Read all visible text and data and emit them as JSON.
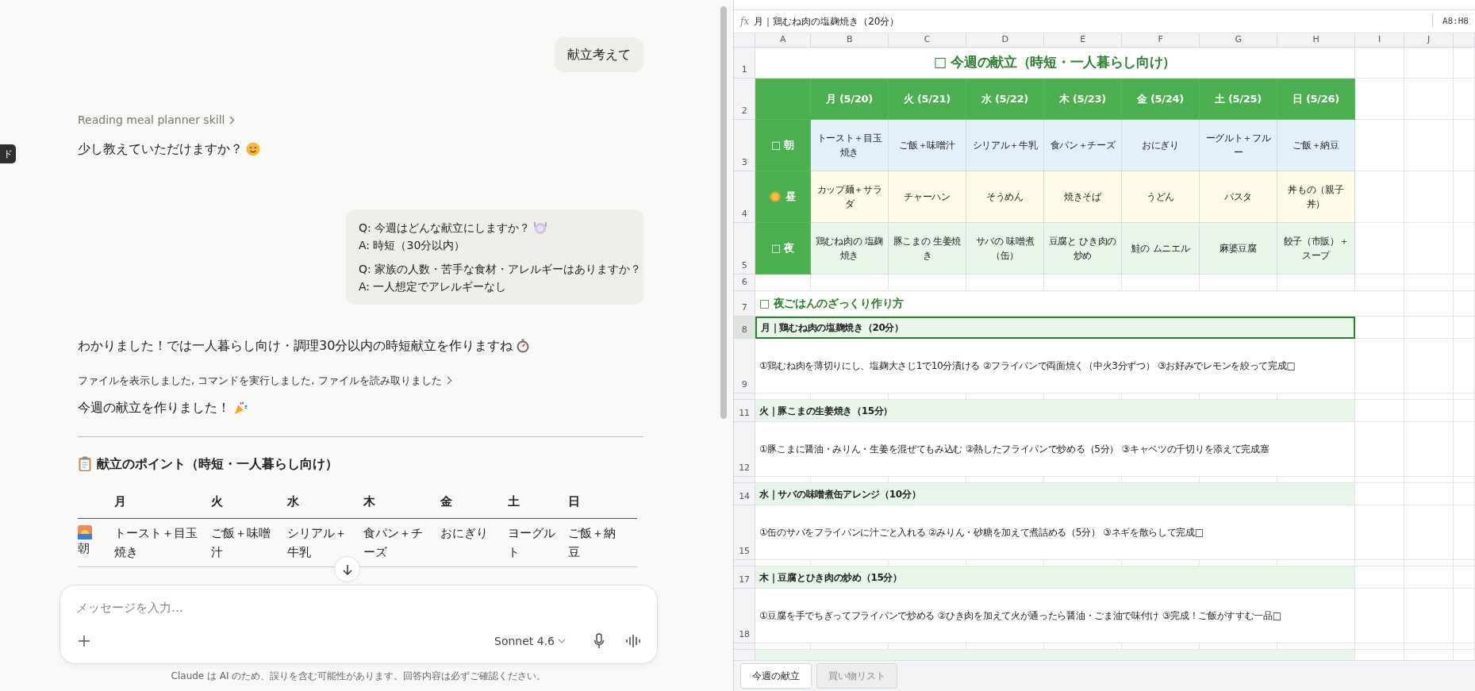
{
  "edge_tooltip": "ド",
  "chat": {
    "messages": [
      {
        "kind": "user",
        "text": "献立考えて"
      },
      {
        "kind": "skill",
        "text": "Reading meal planner skill"
      },
      {
        "kind": "text",
        "text": "少し教えていただけますか？"
      },
      {
        "kind": "qa",
        "pairs": [
          {
            "q": "Q: 今週はどんな献立にしますか？",
            "a": "A: 時短（30分以内）"
          },
          {
            "q": "Q: 家族の人数・苦手な食材・アレルギーはありますか？",
            "a": "A: 一人想定でアレルギーなし"
          }
        ]
      },
      {
        "kind": "text",
        "text": "わかりました！では一人暮らし向け・調理30分以内の時短献立を作りますね"
      },
      {
        "kind": "files",
        "text": "ファイルを表示しました, コマンドを実行しました, ファイルを読み取りました"
      },
      {
        "kind": "text",
        "text": "今週の献立を作りました！"
      },
      {
        "kind": "rule"
      },
      {
        "kind": "heading",
        "text": "献立のポイント（時短・一人暮らし向け）"
      },
      {
        "kind": "table",
        "columns": [
          "月",
          "火",
          "水",
          "木",
          "金",
          "土",
          "日"
        ],
        "rows": [
          {
            "label": "朝",
            "cells": [
              "トースト＋目玉焼き",
              "ご飯＋味噌汁",
              "シリアル＋牛乳",
              "食パン＋チーズ",
              "おにぎり",
              "ヨーグルト",
              "ご飯＋納豆"
            ]
          }
        ]
      }
    ],
    "composer": {
      "placeholder": "メッセージを入力…",
      "model": "Sonnet 4.6"
    },
    "disclaimer": "Claude は AI のため、誤りを含む可能性があります。回答内容は必ずご確認ください。"
  },
  "sheet": {
    "formula_label": "fx",
    "formula": "月｜鶏むね肉の塩麹焼き（20分）",
    "range": "A8:H8",
    "columns": [
      "A",
      "B",
      "C",
      "D",
      "E",
      "F",
      "G",
      "H",
      "I",
      "J"
    ],
    "row_numbers": [
      "1",
      "2",
      "3",
      "4",
      "5",
      "6",
      "7",
      "8",
      "9",
      "11",
      "12",
      "14",
      "15",
      "17",
      "18"
    ],
    "title": "□ 今週の献立（時短・一人暮らし向け）",
    "days": [
      "月 (5/20)",
      "火 (5/21)",
      "水 (5/22)",
      "木 (5/23)",
      "金 (5/24)",
      "土 (5/25)",
      "日 (5/26)"
    ],
    "meals": [
      {
        "label": "□ 朝",
        "color": "#e3f0fc",
        "cells": [
          "トースト＋目玉焼き",
          "ご飯＋味噌汁",
          "シリアル＋牛乳",
          "食パン＋チーズ",
          "おにぎり",
          "ーグルト＋フルー",
          "ご飯＋納豆"
        ]
      },
      {
        "label": "昼",
        "color": "#fffbe6",
        "cells": [
          "カップ麺＋サラダ",
          "チャーハン",
          "そうめん",
          "焼きそば",
          "うどん",
          "パスタ",
          "丼もの（親子丼）"
        ]
      },
      {
        "label": "□ 夜",
        "color": "#e8f5e9",
        "cells": [
          "鶏むね肉の 塩麹焼き",
          "豚こまの 生姜焼き",
          "サバの 味噌煮（缶）",
          "豆腐と ひき肉の炒め",
          "鮭の ムニエル",
          "麻婆豆腐",
          "餃子（市販）＋スープ"
        ]
      }
    ],
    "section": "□ 夜ごはんのざっくり作り方",
    "recipes": [
      {
        "title": "月｜鶏むね肉の塩麹焼き（20分）",
        "steps": "①鶏むね肉を薄切りにし、塩麹大さじ1で10分漬ける ②フライパンで両面焼く（中火3分ずつ） ③お好みでレモンを絞って完成□",
        "selected": true
      },
      {
        "title": "火｜豚こまの生姜焼き（15分）",
        "steps": "①豚こまに醤油・みりん・生姜を混ぜてもみ込む ②熱したフライパンで炒める（5分） ③キャベツの千切りを添えて完成塞",
        "selected": false
      },
      {
        "title": "水｜サバの味噌煮缶アレンジ（10分）",
        "steps": "①缶のサバをフライパンに汁ごと入れる ②みりん・砂糖を加えて煮詰める（5分） ③ネギを散らして完成□",
        "selected": false
      },
      {
        "title": "木｜豆腐とひき肉の炒め（15分）",
        "steps": "①豆腐を手でちぎってフライパンで炒める ②ひき肉を加えて火が通ったら醤油・ごま油で味付け ③完成！ご飯がすすむ一品□",
        "selected": false
      }
    ],
    "tabs": [
      {
        "label": "今週の献立",
        "selected": true
      },
      {
        "label": "買い物リスト",
        "selected": false
      }
    ]
  }
}
